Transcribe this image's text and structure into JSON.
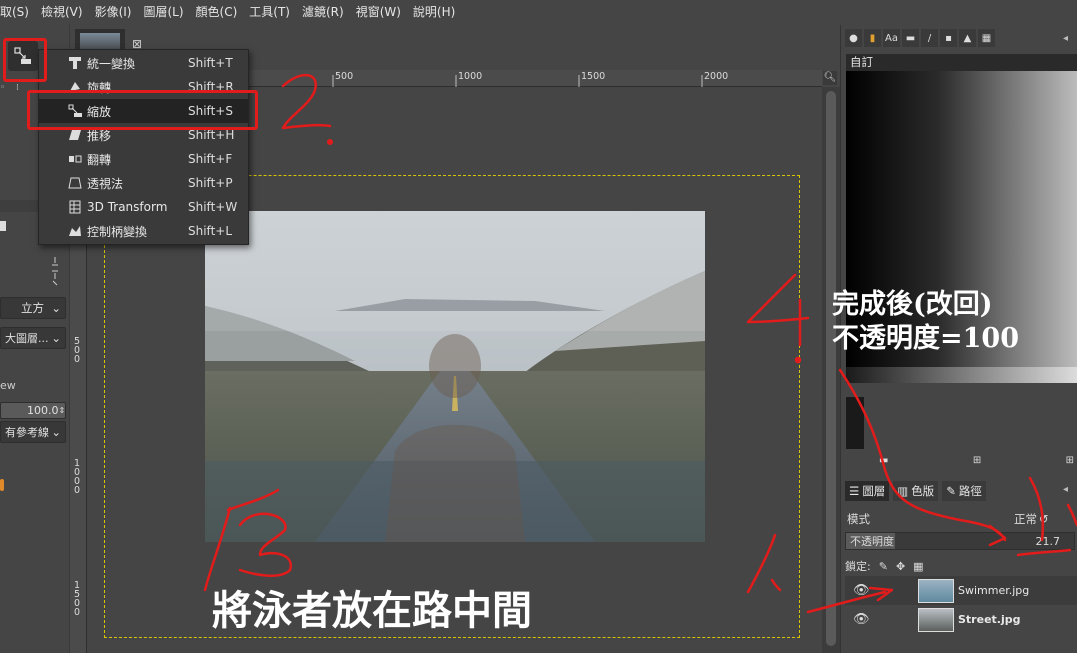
{
  "menubar": {
    "items": [
      "取(S)",
      "檢視(V)",
      "影像(I)",
      "圖層(L)",
      "顏色(C)",
      "工具(T)",
      "濾鏡(R)",
      "視窗(W)",
      "說明(H)"
    ]
  },
  "toolbox": {
    "dropdown_interp": "立方",
    "dropdown_layer": "大圖層...",
    "preview_label": "ew",
    "preview_value": "100.0",
    "guides_dropdown": "有參考線"
  },
  "rulers": {
    "h_ticks": [
      "500",
      "1000",
      "1500",
      "2000"
    ],
    "v_ticks": [
      "500",
      "1000",
      "1500"
    ]
  },
  "transform_menu": {
    "items": [
      {
        "label": "統一變換",
        "shortcut": "Shift+T",
        "icon": "unified-transform-icon"
      },
      {
        "label": "旋轉",
        "shortcut": "Shift+R",
        "icon": "rotate-icon"
      },
      {
        "label": "縮放",
        "shortcut": "Shift+S",
        "icon": "scale-icon"
      },
      {
        "label": "推移",
        "shortcut": "Shift+H",
        "icon": "shear-icon"
      },
      {
        "label": "翻轉",
        "shortcut": "Shift+F",
        "icon": "flip-icon"
      },
      {
        "label": "透視法",
        "shortcut": "Shift+P",
        "icon": "perspective-icon"
      },
      {
        "label": "3D Transform",
        "shortcut": "Shift+W",
        "icon": "3d-transform-icon"
      },
      {
        "label": "控制柄變換",
        "shortcut": "Shift+L",
        "icon": "handle-transform-icon"
      }
    ]
  },
  "dock": {
    "gradient_label": "自訂",
    "tabs": [
      "圖層",
      "色版",
      "路徑"
    ],
    "mode_label": "模式",
    "mode_value": "正常",
    "opacity_label": "不透明度",
    "opacity_value": "21.7",
    "opacity_fraction": 0.217,
    "lock_label": "鎖定:",
    "layers": [
      {
        "name": "Swimmer.jpg",
        "selected": true
      },
      {
        "name": "Street.jpg",
        "selected": false
      }
    ]
  },
  "annotations": {
    "num1": "1.",
    "num2": "2.",
    "num3": "3",
    "num4": "4.",
    "caption_main": "將泳者放在路中間",
    "note_line1": "完成後(改回)",
    "note_line2": "不透明度=100",
    "color": "#e21b1b"
  }
}
